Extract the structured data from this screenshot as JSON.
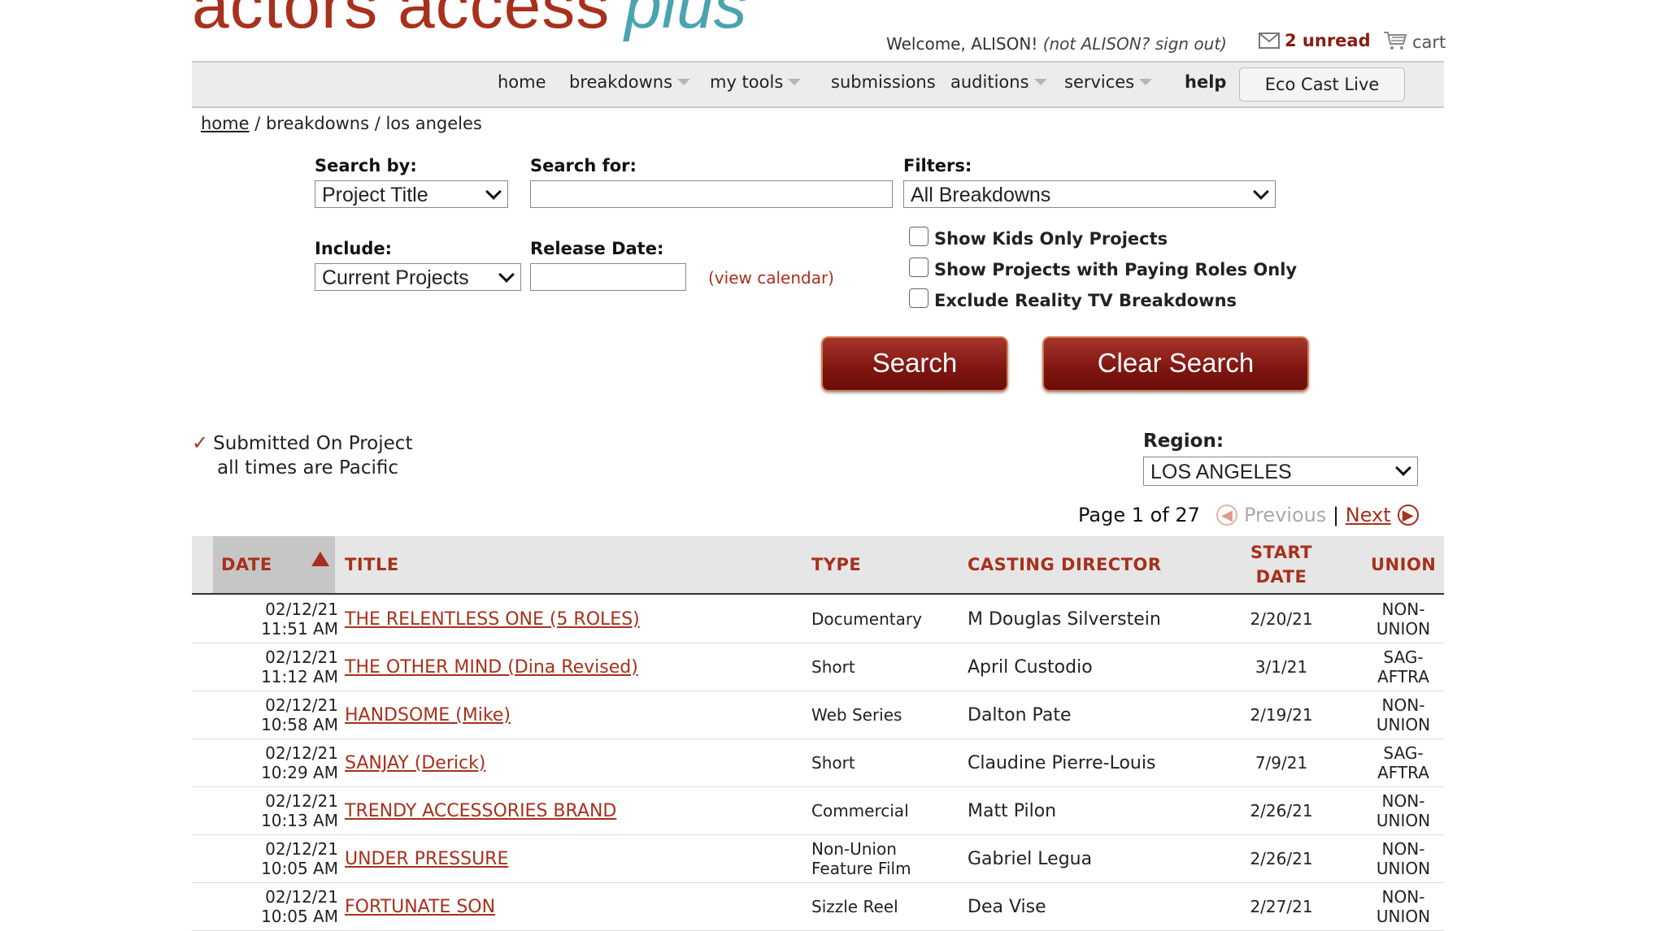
{
  "header": {
    "logo_main": "actors access",
    "logo_plus": "plus",
    "welcome_prefix": "Welcome, ALISON!",
    "welcome_signout": "(not ALISON? sign out)",
    "unread": "2 unread",
    "cart": "cart"
  },
  "nav": {
    "home": "home",
    "breakdowns": "breakdowns",
    "my_tools": "my tools",
    "submissions": "submissions",
    "auditions": "auditions",
    "services": "services",
    "help": "help",
    "eco_cast": "Eco Cast Live"
  },
  "breadcrumb": {
    "home": "home",
    "rest": " / breakdowns / los angeles"
  },
  "search": {
    "search_by_label": "Search by:",
    "search_by_value": "Project Title",
    "search_for_label": "Search for:",
    "search_for_value": "",
    "filters_label": "Filters:",
    "filters_value": "All Breakdowns",
    "include_label": "Include:",
    "include_value": "Current Projects",
    "release_label": "Release Date:",
    "release_value": "",
    "view_calendar": "(view calendar)",
    "chk_kids": "Show Kids Only Projects",
    "chk_paying": "Show Projects with Paying Roles Only",
    "chk_reality": "Exclude Reality TV Breakdowns",
    "search_button": "Search",
    "clear_button": "Clear Search"
  },
  "legend": {
    "submitted": "Submitted On Project",
    "times": "all times are Pacific"
  },
  "region": {
    "label": "Region:",
    "value": "LOS ANGELES"
  },
  "pager": {
    "page_text": "Page 1 of 27",
    "previous": "Previous",
    "separator": "|",
    "next": "Next"
  },
  "table": {
    "headers": {
      "date": "DATE",
      "title": "TITLE",
      "type": "TYPE",
      "casting": "CASTING DIRECTOR",
      "start1": "START",
      "start2": "DATE",
      "union": "UNION"
    },
    "rows": [
      {
        "date": "02/12/21",
        "time": "11:51 AM",
        "title": "THE RELENTLESS ONE (5 ROLES)",
        "type1": "Documentary",
        "type2": "",
        "cd": "M Douglas Silverstein",
        "start": "2/20/21",
        "union1": "NON-",
        "union2": "UNION"
      },
      {
        "date": "02/12/21",
        "time": "11:12 AM",
        "title": "THE OTHER MIND (Dina Revised)",
        "type1": "Short",
        "type2": "",
        "cd": "April Custodio",
        "start": "3/1/21",
        "union1": "SAG-",
        "union2": "AFTRA"
      },
      {
        "date": "02/12/21",
        "time": "10:58 AM",
        "title": "HANDSOME (Mike)",
        "type1": "Web Series",
        "type2": "",
        "cd": "Dalton Pate",
        "start": "2/19/21",
        "union1": "NON-",
        "union2": "UNION"
      },
      {
        "date": "02/12/21",
        "time": "10:29 AM",
        "title": "SANJAY (Derick)",
        "type1": "Short",
        "type2": "",
        "cd": "Claudine Pierre-Louis",
        "start": "7/9/21",
        "union1": "SAG-",
        "union2": "AFTRA"
      },
      {
        "date": "02/12/21",
        "time": "10:13 AM",
        "title": "TRENDY ACCESSORIES BRAND",
        "type1": "Commercial",
        "type2": "",
        "cd": "Matt Pilon",
        "start": "2/26/21",
        "union1": "NON-",
        "union2": "UNION"
      },
      {
        "date": "02/12/21",
        "time": "10:05 AM",
        "title": "UNDER PRESSURE",
        "type1": "Non-Union",
        "type2": "Feature Film",
        "cd": "Gabriel Legua",
        "start": "2/26/21",
        "union1": "NON-",
        "union2": "UNION"
      },
      {
        "date": "02/12/21",
        "time": "10:05 AM",
        "title": "FORTUNATE SON",
        "type1": "Sizzle Reel",
        "type2": "",
        "cd": "Dea Vise",
        "start": "2/27/21",
        "union1": "NON-",
        "union2": "UNION"
      }
    ]
  },
  "colors": {
    "brand_red": "#a8301c",
    "brand_teal": "#4ba3b0",
    "button_red": "#7e1510",
    "nav_bg": "#ececec"
  }
}
